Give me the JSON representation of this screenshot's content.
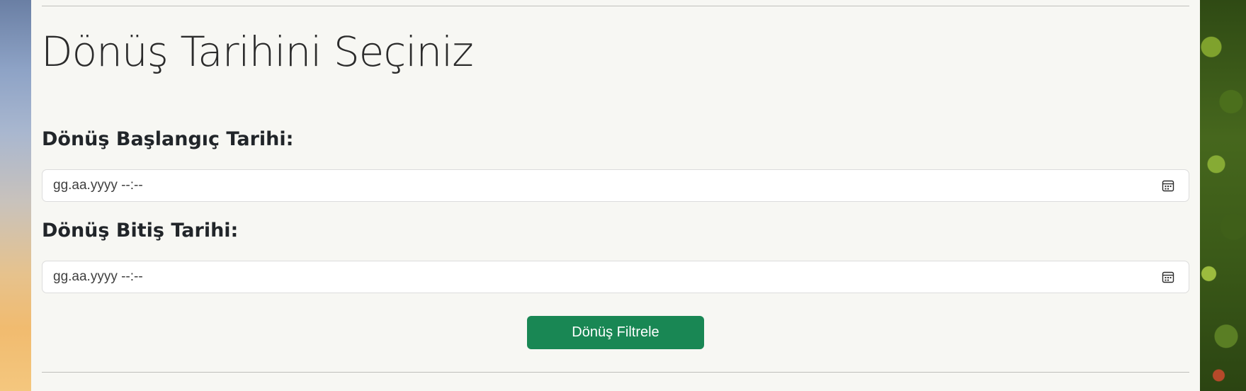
{
  "page": {
    "title": "Dönüş Tarihini Seçiniz"
  },
  "form": {
    "start": {
      "label": "Dönüş Başlangıç Tarihi:",
      "placeholder": "gg.aa.yyyy --:--",
      "value": "",
      "icon": "calendar-icon"
    },
    "end": {
      "label": "Dönüş Bitiş Tarihi:",
      "placeholder": "gg.aa.yyyy --:--",
      "value": "",
      "icon": "calendar-icon"
    },
    "submit_label": "Dönüş Filtrele"
  },
  "colors": {
    "button": "#198754",
    "panel": "#f7f7f3",
    "text": "#212529"
  }
}
